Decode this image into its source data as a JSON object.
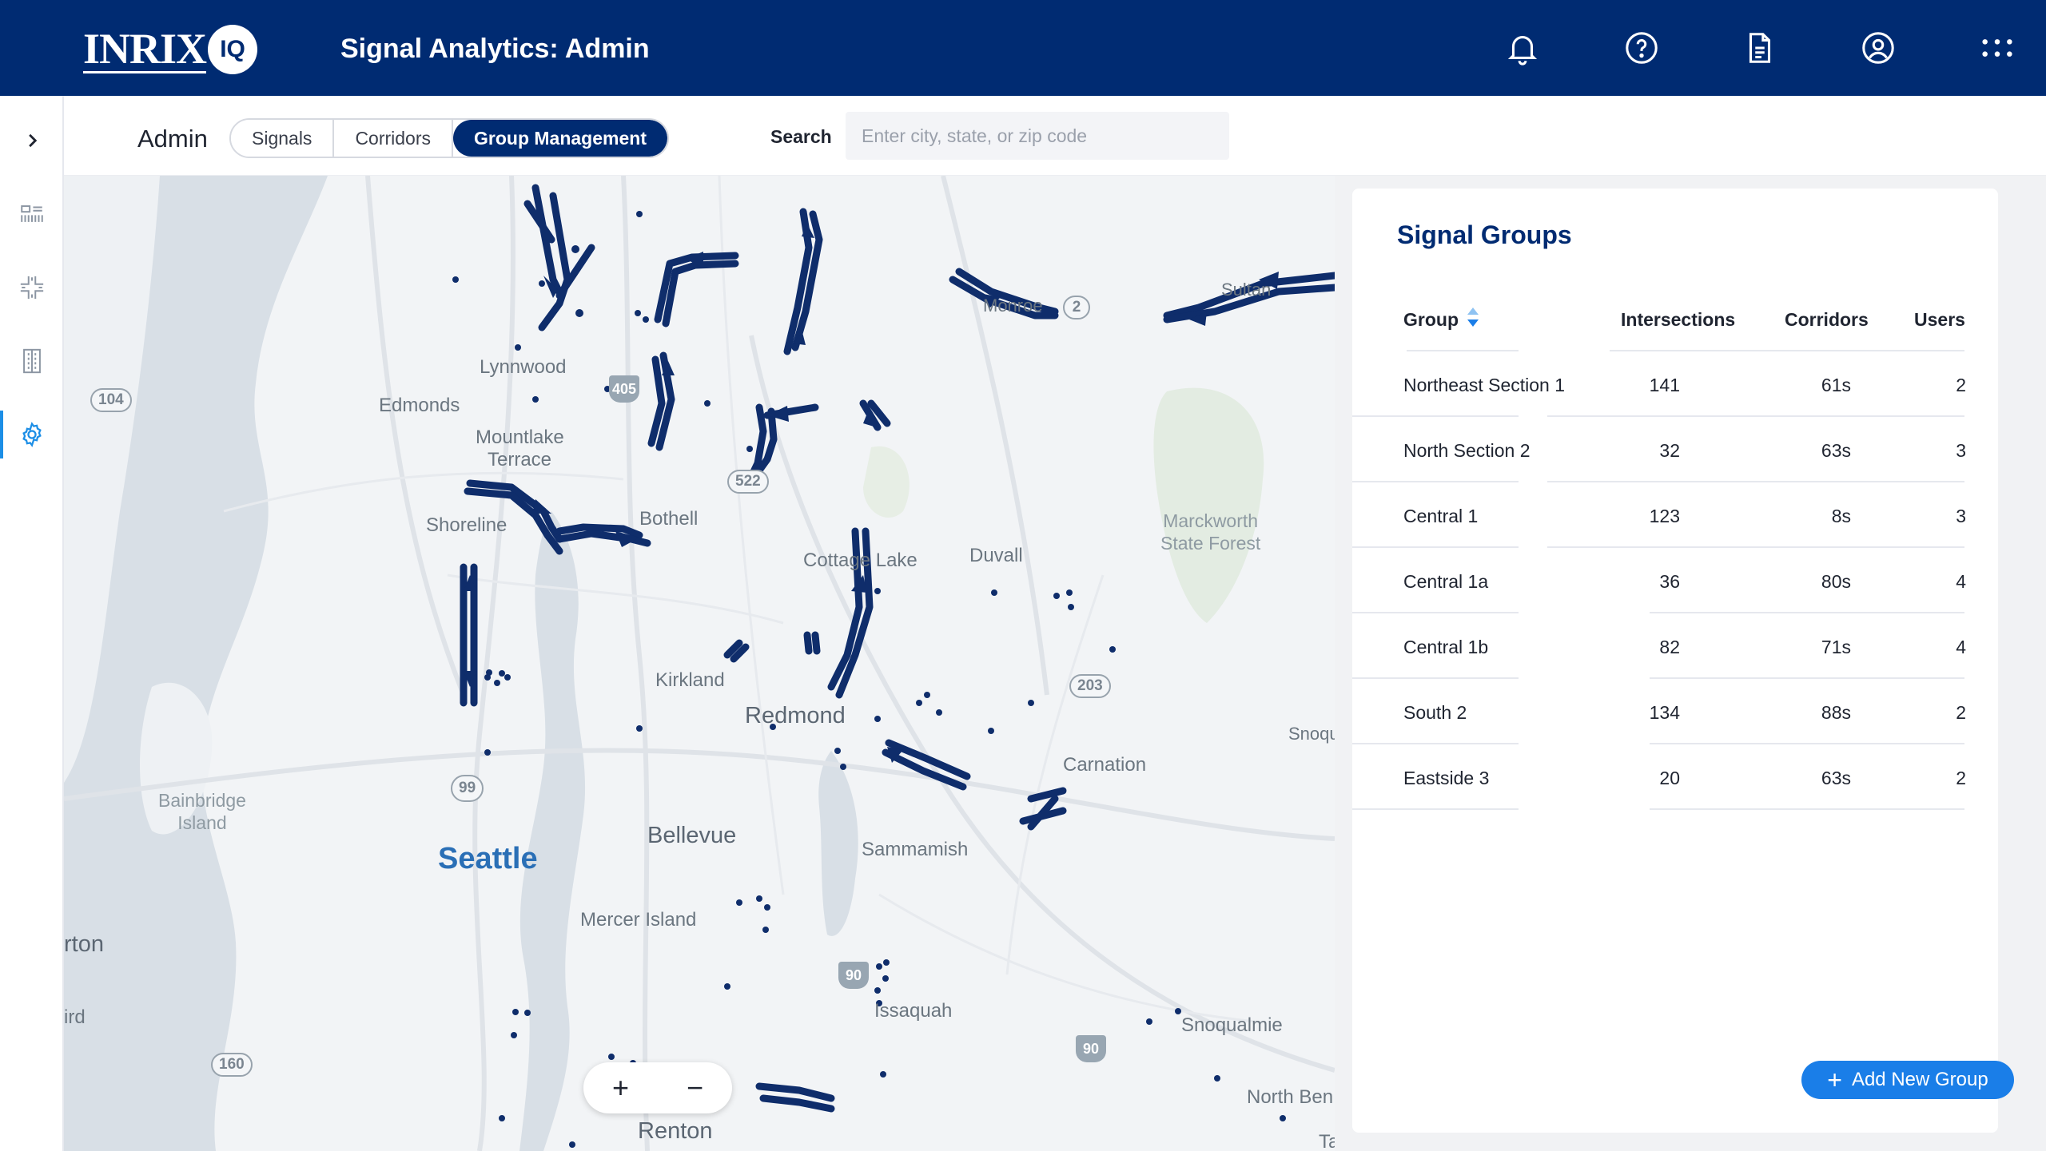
{
  "header": {
    "logo_text": "INRIX",
    "logo_badge": "IQ",
    "title": "Signal Analytics: Admin",
    "icons": [
      "bell-icon",
      "help-circle-icon",
      "document-icon",
      "user-circle-icon",
      "apps-grid-icon"
    ]
  },
  "sidebar": {
    "items": [
      {
        "icon": "chevron-right-icon"
      },
      {
        "icon": "barcode-icon"
      },
      {
        "icon": "intersection-icon"
      },
      {
        "icon": "building-icon"
      },
      {
        "icon": "gear-icon",
        "active": true
      }
    ]
  },
  "subnav": {
    "section_label": "Admin",
    "tabs": [
      {
        "label": "Signals",
        "active": false
      },
      {
        "label": "Corridors",
        "active": false
      },
      {
        "label": "Group Management",
        "active": true
      }
    ],
    "search_label": "Search",
    "search_placeholder": "Enter city, state, or zip code",
    "search_value": ""
  },
  "map": {
    "labels": {
      "lynnwood": "Lynnwood",
      "edmonds": "Edmonds",
      "mountlake": "Mountlake",
      "terrace": "Terrace",
      "shoreline": "Shoreline",
      "bothell": "Bothell",
      "cottage_lake": "Cottage Lake",
      "duvall": "Duvall",
      "marckworth": "Marckworth",
      "state_forest": "State Forest",
      "kirkland": "Kirkland",
      "redmond": "Redmond",
      "carnation": "Carnation",
      "snoq_edge": "Snoqu",
      "bainbridge": "Bainbridge",
      "island": "Island",
      "seattle": "Seattle",
      "bellevue": "Bellevue",
      "sammamish": "Sammamish",
      "mercer_island": "Mercer Island",
      "rton": "rton",
      "ird": "ird",
      "issaquah": "Issaquah",
      "snoqualmie": "Snoqualmie",
      "north_bend": "North Ben",
      "renton": "Renton",
      "sultan": "Sultan",
      "monroe": "Monroe",
      "ta": "Ta"
    },
    "shields": {
      "r104": "104",
      "r405": "405",
      "r522": "522",
      "r2": "2",
      "r203": "203",
      "r99": "99",
      "r90a": "90",
      "r90b": "90",
      "r160": "160"
    },
    "zoom_in": "+",
    "zoom_out": "−"
  },
  "panel": {
    "title": "Signal Groups",
    "columns": {
      "group": "Group",
      "intersections": "Intersections",
      "corridors": "Corridors",
      "users": "Users"
    },
    "rows": [
      {
        "group": "Northeast Section 1",
        "intersections": "141",
        "corridors": "61s",
        "users": "2"
      },
      {
        "group": "North Section 2",
        "intersections": "32",
        "corridors": "63s",
        "users": "3"
      },
      {
        "group": "Central 1",
        "intersections": "123",
        "corridors": "8s",
        "users": "3"
      },
      {
        "group": "Central 1a",
        "intersections": "36",
        "corridors": "80s",
        "users": "4"
      },
      {
        "group": "Central 1b",
        "intersections": "82",
        "corridors": "71s",
        "users": "4"
      },
      {
        "group": "South 2",
        "intersections": "134",
        "corridors": "88s",
        "users": "2"
      },
      {
        "group": "Eastside 3",
        "intersections": "20",
        "corridors": "63s",
        "users": "2"
      }
    ],
    "add_button": "Add New Group"
  },
  "colors": {
    "brand_navy": "#002b72",
    "accent_blue": "#1a7ee8",
    "corridor": "#0f2d6b"
  }
}
